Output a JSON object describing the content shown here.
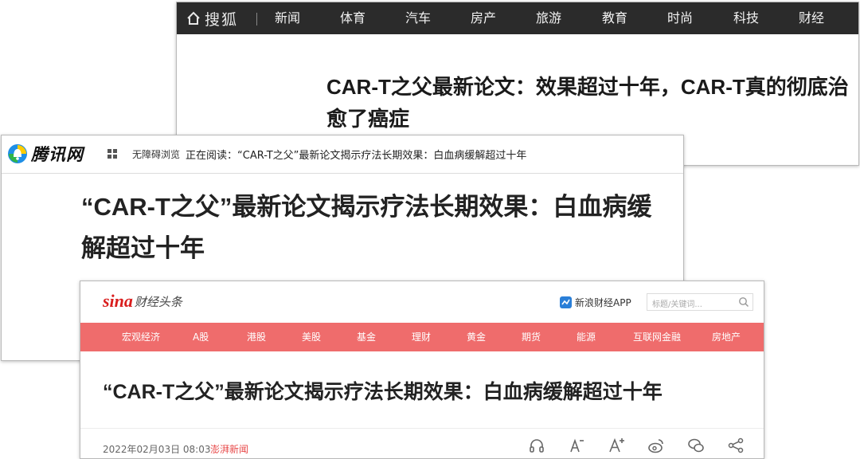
{
  "sohu": {
    "logo_text": "搜狐",
    "nav": [
      "新闻",
      "体育",
      "汽车",
      "房产",
      "旅游",
      "教育",
      "时尚",
      "科技",
      "财经"
    ],
    "title": "CAR-T之父最新论文：效果超过十年，CAR-T真的彻底治愈了癌症"
  },
  "tencent": {
    "logo_text": "腾讯网",
    "accessibility": "无障碍浏览",
    "reading_label": "正在阅读：",
    "reading_title": "“CAR-T之父”最新论文揭示疗法长期效果：白血病缓解超过十年",
    "title": "“CAR-T之父”最新论文揭示疗法长期效果：白血病缓解超过十年"
  },
  "sina": {
    "logo_sina": "sina",
    "logo_text": "财经头条",
    "app_label": "新浪财经APP",
    "search_placeholder": "标题/关键词...",
    "nav": [
      "宏观经济",
      "A股",
      "港股",
      "美股",
      "基金",
      "理财",
      "黄金",
      "期货",
      "能源",
      "互联网金融",
      "房地产"
    ],
    "title": "“CAR-T之父”最新论文揭示疗法长期效果：白血病缓解超过十年",
    "date": "2022年02月03日 08:03",
    "source": "澎湃新闻",
    "tool_icons": [
      "headphones-icon",
      "font-decrease-icon",
      "font-increase-icon",
      "weibo-icon",
      "wechat-icon",
      "share-icon"
    ]
  },
  "colors": {
    "sohu_nav_bg": "#2b2b2b",
    "sina_nav_bg": "#ef6c6c",
    "sina_source": "#e84a4a",
    "sina_logo_red": "#d91d1d"
  }
}
